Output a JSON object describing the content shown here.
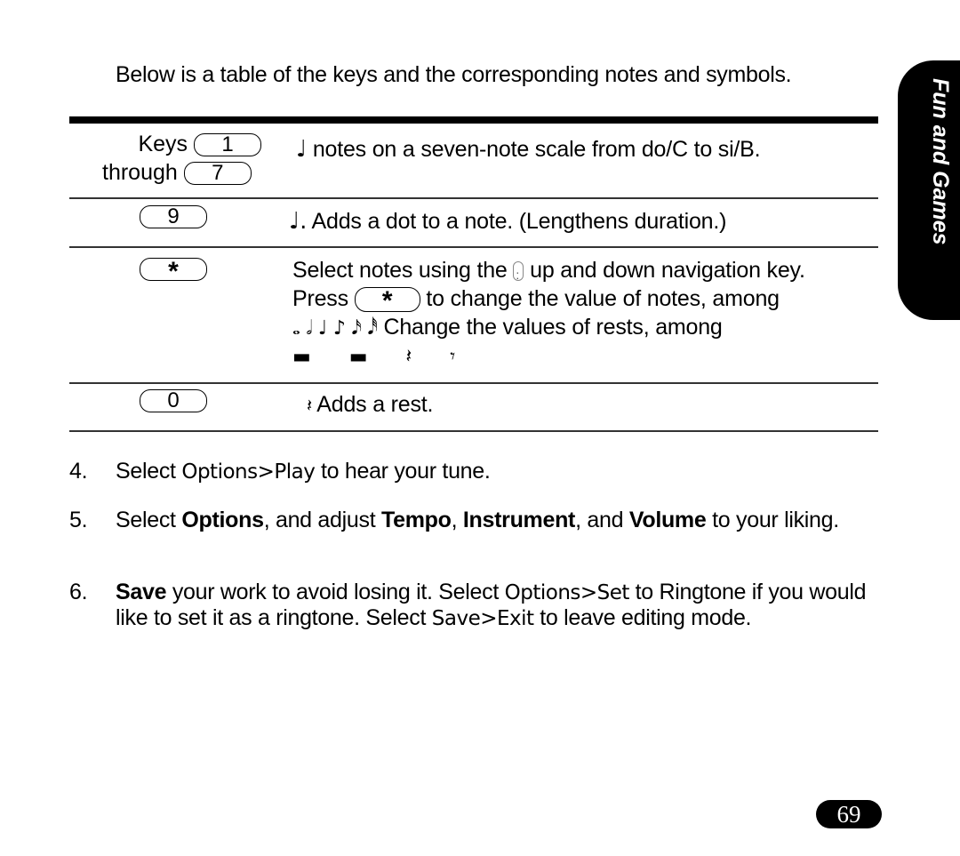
{
  "intro": "Below is a table of the keys and the corresponding notes and symbols.",
  "table": {
    "rows": [
      {
        "key_label_1": "Keys",
        "key_1": "1",
        "key_label_2": "through",
        "key_2": "7",
        "icon": "quarter-note-icon",
        "icon_glyph": "♩",
        "description": "notes on a seven-note scale from do/C to si/B."
      },
      {
        "key": "9",
        "icon": "dotted-note-icon",
        "icon_glyph": "♩.",
        "description": "Adds a dot to a note. (Lengthens duration.)"
      },
      {
        "key": "*",
        "line1_a": "Select notes using the",
        "line1_icon": "nav-key-icon",
        "line1_b": "up and down navigation key.",
        "line2_a": "Press",
        "line2_key": "*",
        "line2_b": "to change the value of notes, among",
        "note_values": "𝅝 𝅗𝅥 ♩ ♪ 𝅘𝅥𝅯 𝅘𝅥𝅰",
        "line3": "Change the values of rests, among",
        "rest_values": "▬ ▬ 𝄽 𝄾"
      },
      {
        "key": "0",
        "icon": "rest-icon",
        "icon_glyph": "𝄽",
        "description": "Adds a rest."
      }
    ]
  },
  "steps": [
    {
      "num": "4.",
      "parts": [
        "Select ",
        "Options>Play",
        " to hear your tune."
      ]
    },
    {
      "num": "5.",
      "parts": [
        "Select ",
        "Options",
        ", and adjust ",
        "Tempo",
        ", ",
        "Instrument",
        ", and ",
        "Volume",
        " to your liking."
      ]
    },
    {
      "num": "6.",
      "parts": [
        "Save",
        " your work to avoid losing it. Select ",
        "Options>Set",
        " to Ringtone if you would like to set it as a ringtone. Select ",
        "Save>Exit",
        " to leave editing mode."
      ]
    }
  ],
  "side_tab": "Fun and Games",
  "page_number": "69"
}
